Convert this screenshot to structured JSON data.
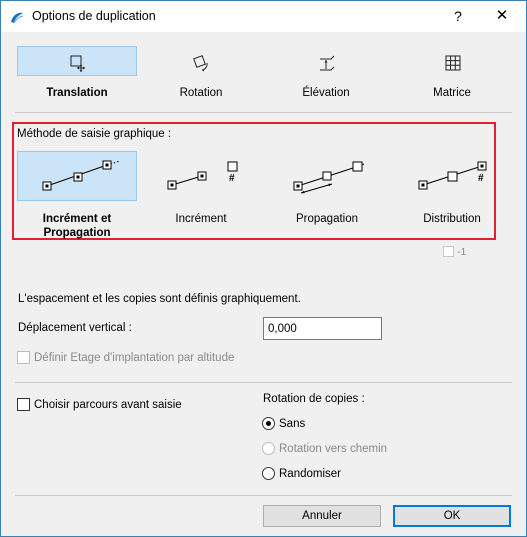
{
  "window": {
    "title": "Options de duplication",
    "help_label": "?",
    "close_label": "✕"
  },
  "modes": {
    "translation": "Translation",
    "rotation": "Rotation",
    "elevation": "Élévation",
    "matrice": "Matrice",
    "selected": "Translation"
  },
  "method": {
    "title": "Méthode de saisie graphique :",
    "increment_propagation_line1": "Incrément et",
    "increment_propagation_line2": "Propagation",
    "increment": "Incrément",
    "propagation": "Propagation",
    "distribution": "Distribution",
    "hash_symbol": "#",
    "minus_one_label": "-1",
    "selected": "Incrément et Propagation"
  },
  "spacing": {
    "info": "L'espacement et les copies sont définis graphiquement.",
    "vertical_label": "Déplacement vertical :",
    "vertical_value": "0,000",
    "altitude_checkbox": "Définir Etage d'implantation par altitude"
  },
  "path": {
    "choose_path_checkbox": "Choisir parcours avant saisie"
  },
  "rotation_copies": {
    "title": "Rotation de copies :",
    "options": [
      "Sans",
      "Rotation vers chemin",
      "Randomiser"
    ],
    "selected": "Sans"
  },
  "buttons": {
    "cancel": "Annuler",
    "ok": "OK"
  },
  "colors": {
    "accent_selected": "#cce4f7",
    "highlight_frame": "#e0202a",
    "default_button_border": "#0078d7"
  }
}
